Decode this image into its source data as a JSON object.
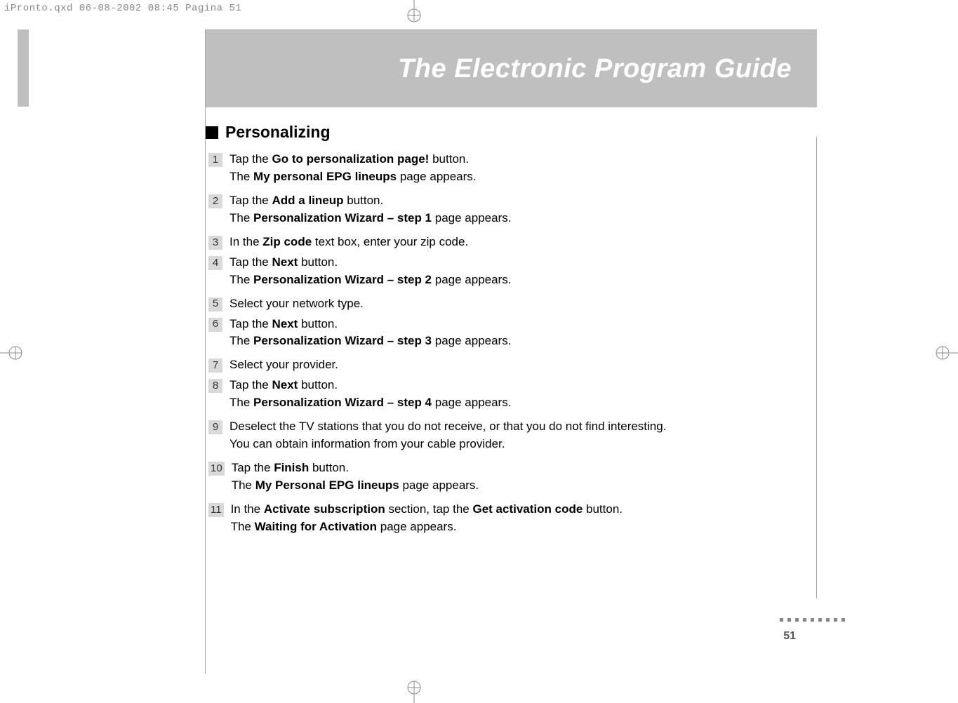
{
  "print_header": "iPronto.qxd  06-08-2002  08:45  Pagina 51",
  "title": "The Electronic Program Guide",
  "section_heading": "Personalizing",
  "steps": [
    {
      "num": "1",
      "l1_a": "Tap the ",
      "l1_b": "Go to personalization page!",
      "l1_c": " button.",
      "l2_a": "The ",
      "l2_b": "My personal EPG lineups",
      "l2_c": " page appears."
    },
    {
      "num": "2",
      "l1_a": "Tap the ",
      "l1_b": "Add a lineup",
      "l1_c": " button.",
      "l2_a": "The ",
      "l2_b": "Personalization Wizard – step 1",
      "l2_c": " page appears."
    },
    {
      "num": "3",
      "l1_a": "In the ",
      "l1_b": "Zip code",
      "l1_c": " text box, enter your zip code."
    },
    {
      "num": "4",
      "l1_a": "Tap the ",
      "l1_b": "Next",
      "l1_c": " button.",
      "l2_a": "The ",
      "l2_b": "Personalization Wizard – step 2",
      "l2_c": " page appears."
    },
    {
      "num": "5",
      "l1_plain": "Select your network type."
    },
    {
      "num": "6",
      "l1_a": "Tap the ",
      "l1_b": "Next",
      "l1_c": " button.",
      "l2_a": "The ",
      "l2_b": "Personalization Wizard – step 3",
      "l2_c": " page appears."
    },
    {
      "num": "7",
      "l1_plain": "Select your provider."
    },
    {
      "num": "8",
      "l1_a": "Tap the ",
      "l1_b": "Next",
      "l1_c": " button.",
      "l2_a": "The ",
      "l2_b": "Personalization Wizard – step 4",
      "l2_c": " page appears."
    },
    {
      "num": "9",
      "l1_plain": "Deselect the TV stations that you do not receive, or that you do not find interesting.",
      "l2_plain": "You can obtain information from your cable provider."
    },
    {
      "num": "10",
      "l1_a": "Tap the ",
      "l1_b": "Finish",
      "l1_c": " button.",
      "l2_a": "The ",
      "l2_b": "My Personal EPG lineups",
      "l2_c": " page appears."
    },
    {
      "num": "11",
      "l1_a": "In the ",
      "l1_b": "Activate subscription",
      "l1_c": " section, tap the ",
      "l1_d": "Get activation code",
      "l1_e": " button.",
      "l2_a": "The ",
      "l2_b": "Waiting for Activation",
      "l2_c": " page appears."
    }
  ],
  "page_number": "51"
}
